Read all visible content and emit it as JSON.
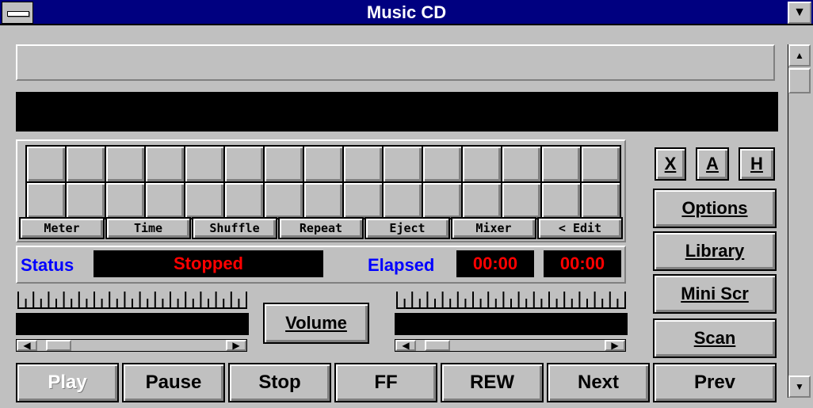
{
  "window": {
    "title": "Music CD",
    "minimize_glyph": "▼"
  },
  "display": {
    "top_bar_text": "",
    "lcd_text": ""
  },
  "toggles": [
    {
      "name": "meter-button",
      "label": "Meter"
    },
    {
      "name": "time-button",
      "label": "Time"
    },
    {
      "name": "shuffle-button",
      "label": "Shuffle"
    },
    {
      "name": "repeat-button",
      "label": "Repeat"
    },
    {
      "name": "eject-button",
      "label": "Eject"
    },
    {
      "name": "mixer-button",
      "label": "Mixer"
    },
    {
      "name": "edit-button",
      "label": "< Edit"
    }
  ],
  "status": {
    "label": "Status",
    "value": "Stopped",
    "elapsed_label": "Elapsed",
    "elapsed": "00:00",
    "total": "00:00"
  },
  "volume": {
    "label": "Volume",
    "left_level": 0.05,
    "right_level": 0.05
  },
  "side": {
    "x_label": "X",
    "a_label": "A",
    "h_label": "H",
    "options": "Options",
    "library": "Library",
    "mini_scr": "Mini Scr",
    "scan": "Scan"
  },
  "transport": [
    "Play",
    "Pause",
    "Stop",
    "FF",
    "REW",
    "Next",
    "Prev"
  ],
  "colors": {
    "title_bar": "#000080",
    "face": "#c0c0c0",
    "lcd": "#000000",
    "status_red": "#ff0000",
    "label_blue": "#0000ff",
    "disabled_text": "#ffffff"
  }
}
